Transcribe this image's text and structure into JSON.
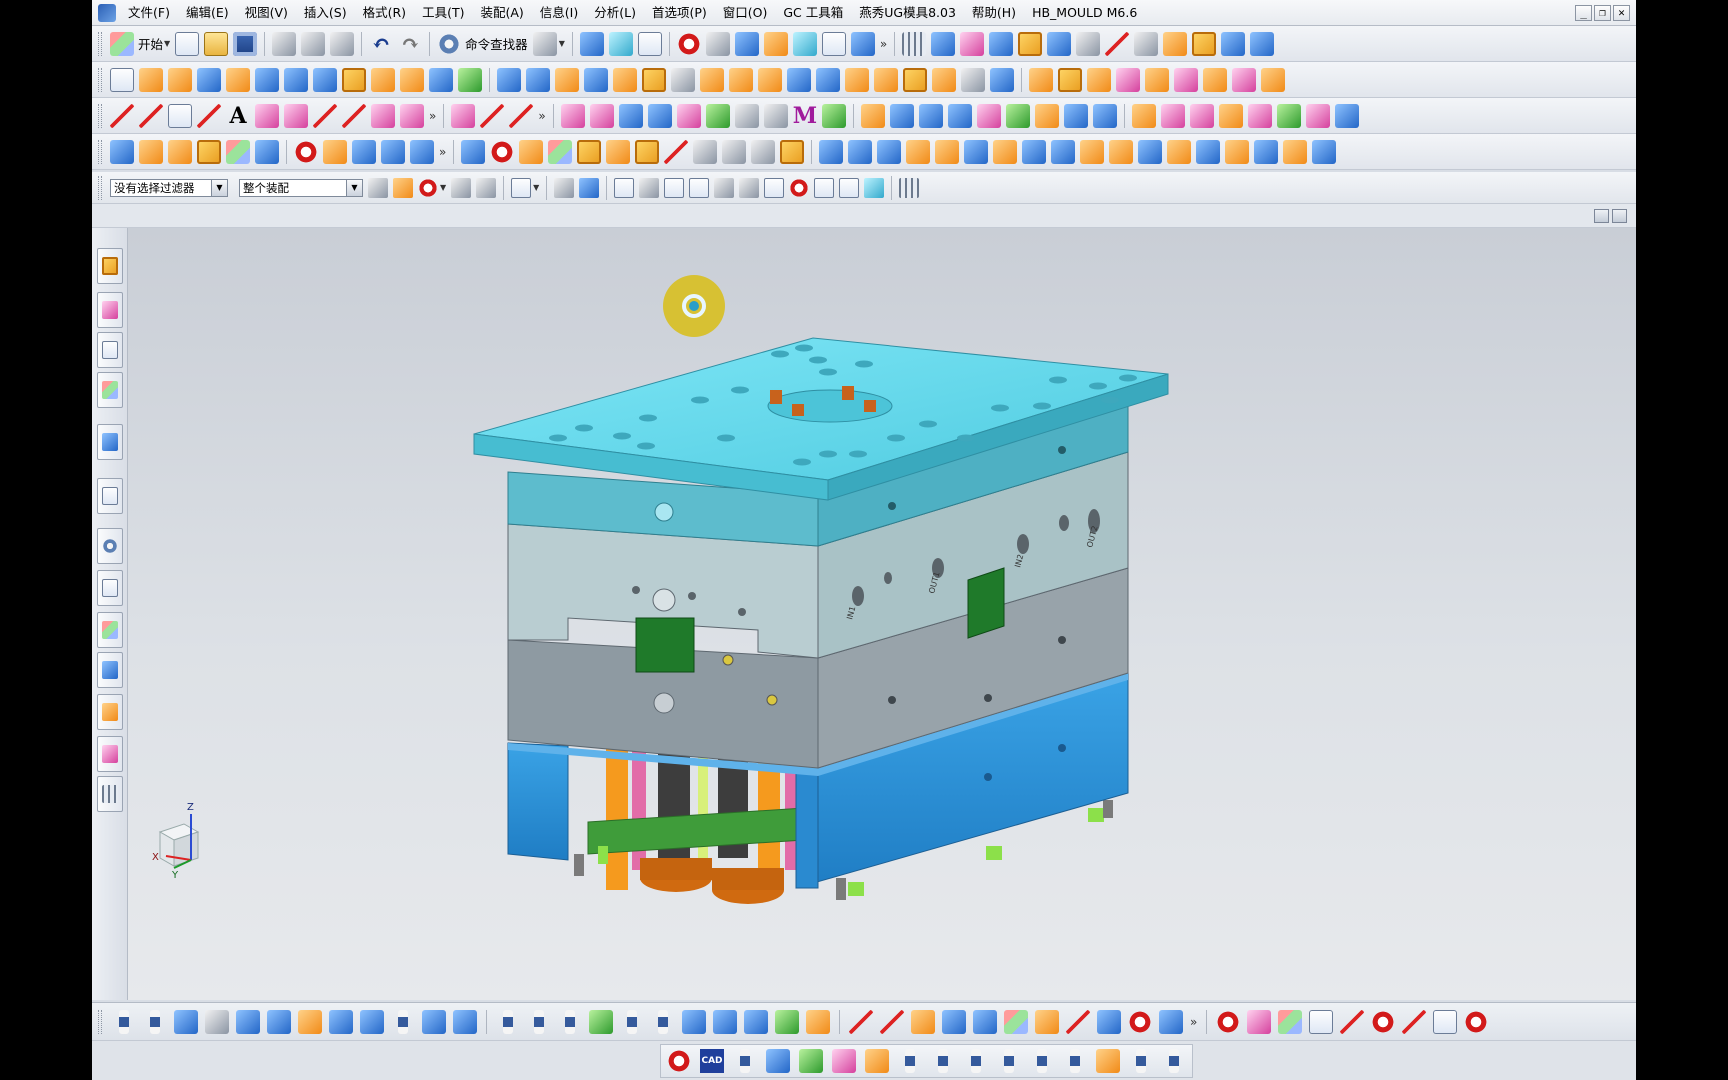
{
  "menubar": {
    "items": [
      "文件(F)",
      "编辑(E)",
      "视图(V)",
      "插入(S)",
      "格式(R)",
      "工具(T)",
      "装配(A)",
      "信息(I)",
      "分析(L)",
      "首选项(P)",
      "窗口(O)",
      "GC 工具箱",
      "燕秀UG模具8.03",
      "帮助(H)",
      "HB_MOULD M6.6"
    ],
    "window_controls": [
      "_",
      "❐",
      "✕"
    ]
  },
  "standard_toolbar": {
    "start_label": "开始",
    "command_finder_label": "命令查找器"
  },
  "selection_bar": {
    "filter_value": "没有选择过滤器",
    "scope_value": "整个装配"
  },
  "viewport": {
    "triad_labels": {
      "z": "Z",
      "x": "X",
      "y": "Y"
    },
    "plate_labels": [
      "IN1",
      "OUT1",
      "IN2",
      "OUT2"
    ]
  },
  "bottom_toolbar_2": {
    "cad_badge": "CAD"
  },
  "colors": {
    "top_plate": "#5fd9ec",
    "a_plate": "#a9d3d6",
    "b_plate": "#8e9aa2",
    "clamp_plate": "#2a8fd3",
    "support_plate": "#2f8f2f",
    "highlight": "#d7c02a"
  }
}
